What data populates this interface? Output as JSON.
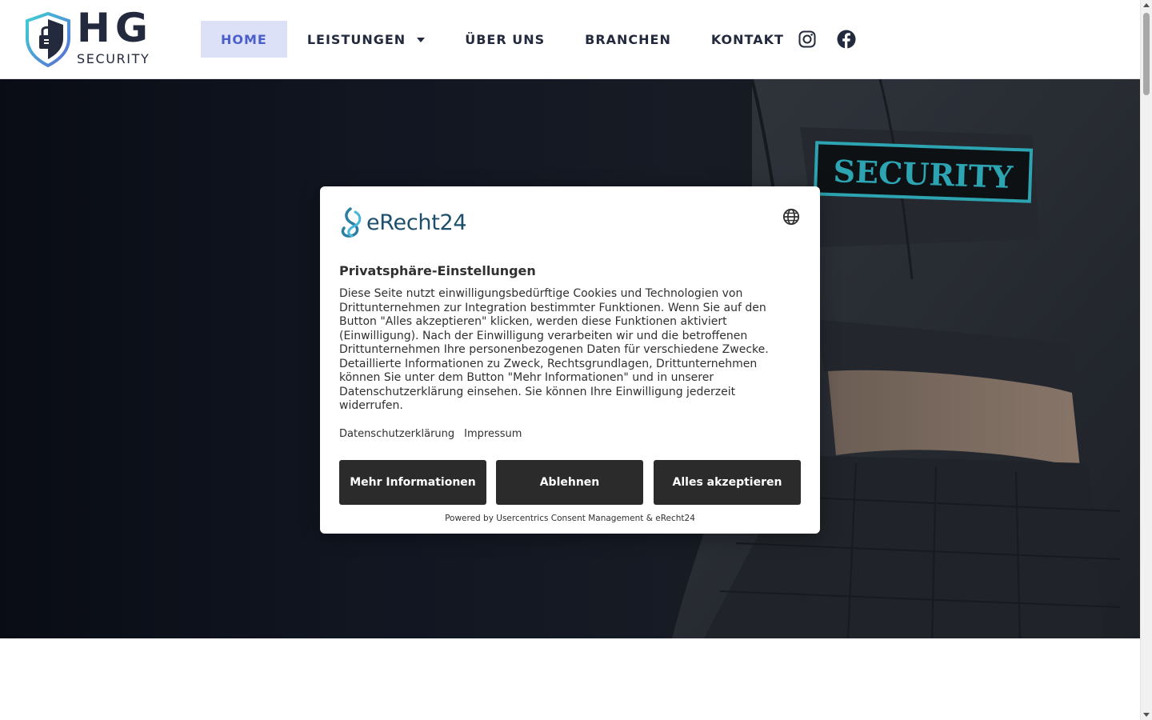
{
  "brand": {
    "name": "HG",
    "tagline": "SECURITY"
  },
  "nav": {
    "items": [
      {
        "label": "HOME",
        "active": true
      },
      {
        "label": "LEISTUNGEN",
        "has_dropdown": true
      },
      {
        "label": "ÜBER UNS"
      },
      {
        "label": "BRANCHEN"
      },
      {
        "label": "KONTAKT"
      }
    ]
  },
  "social": [
    "instagram-icon",
    "facebook-icon"
  ],
  "hero": {
    "patch_text": "SECURITY"
  },
  "consent": {
    "provider_logo": "eRecht24",
    "title": "Privatsphäre-Einstellungen",
    "body": "Diese Seite nutzt einwilligungsbedürftige Cookies und Technologien von Drittunternehmen zur Integration bestimmter Funktionen. Wenn Sie auf den Button \"Alles akzeptieren\" klicken, werden diese Funktionen aktiviert (Einwilligung). Nach der Einwilligung verarbeiten wir und die betroffenen Drittunternehmen Ihre personenbezogenen Daten für verschiedene Zwecke. Detaillierte Informationen zu Zweck, Rechtsgrundlagen, Drittunternehmen können Sie unter dem Button \"Mehr Informationen\" und in unserer Datenschutzerklärung einsehen. Sie können Ihre Einwilligung jederzeit widerrufen.",
    "links": {
      "privacy": "Datenschutzerklärung",
      "imprint": "Impressum"
    },
    "buttons": {
      "more": "Mehr Informationen",
      "decline": "Ablehnen",
      "accept": "Alles akzeptieren"
    },
    "powered_by": "Powered by Usercentrics Consent Management & eRecht24"
  },
  "colors": {
    "brand_dark": "#232a3d",
    "brand_accent": "#4b5fc9",
    "nav_active_bg": "#dde1f7",
    "button_dark": "#2b2b2b",
    "patch_cyan": "#36c1d1"
  }
}
